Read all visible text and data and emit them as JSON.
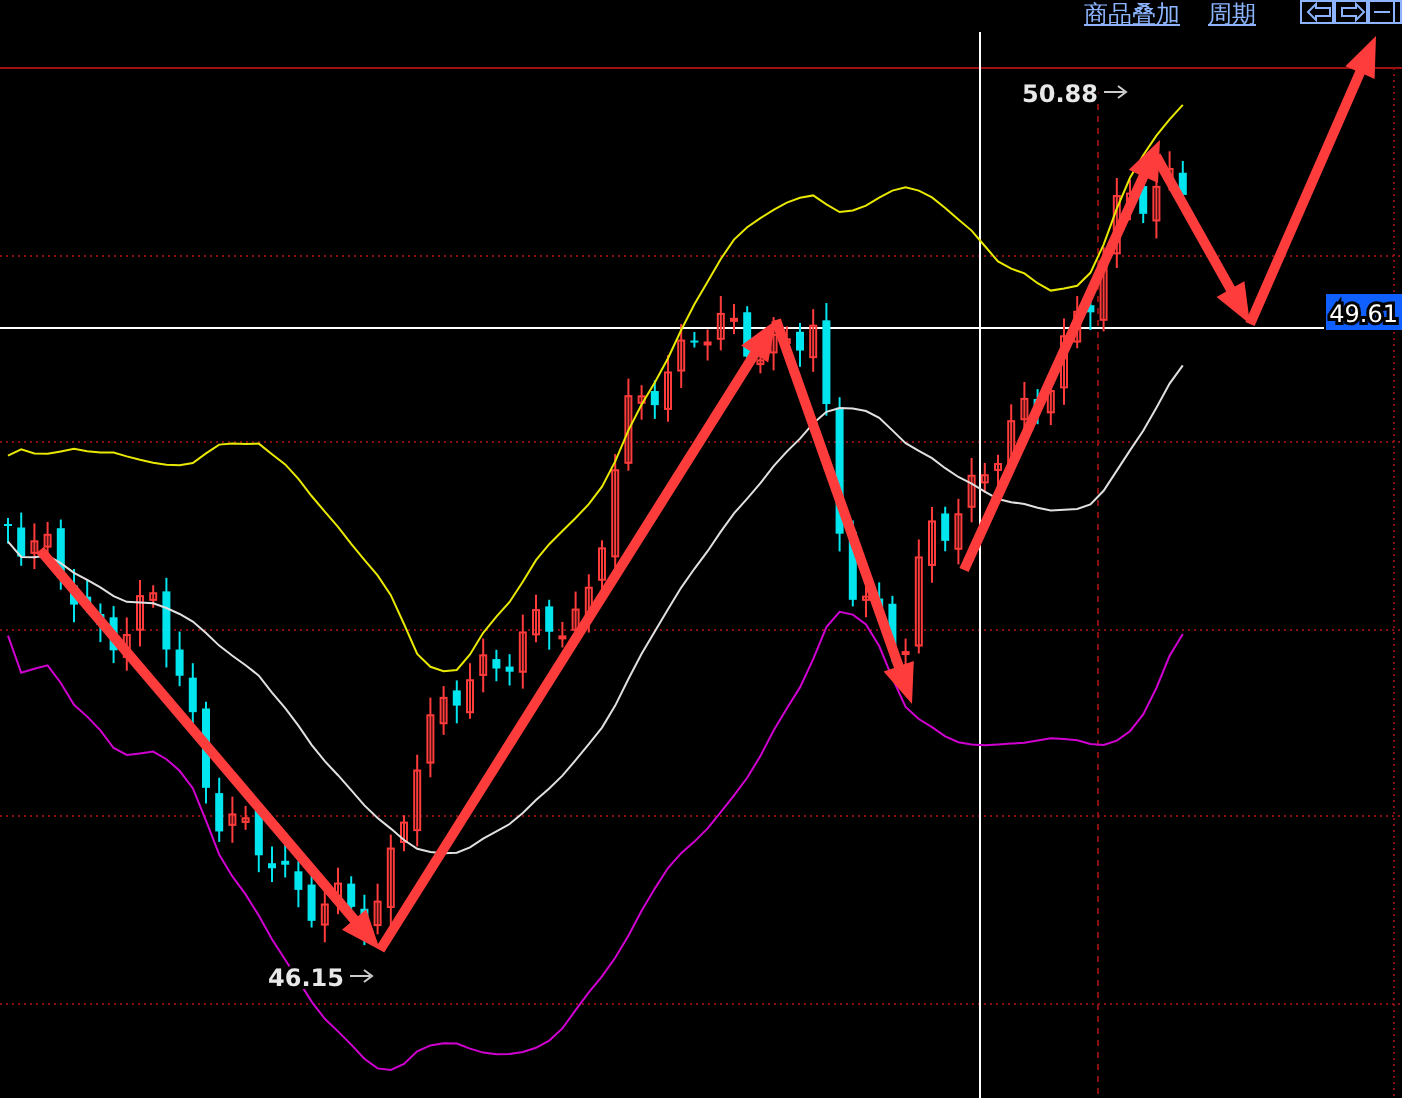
{
  "toolbar": {
    "links": [
      "商品叠加",
      "周期"
    ]
  },
  "chart": {
    "high_label": "50.88",
    "low_label": "46.15",
    "price_tag": "49.61"
  }
}
